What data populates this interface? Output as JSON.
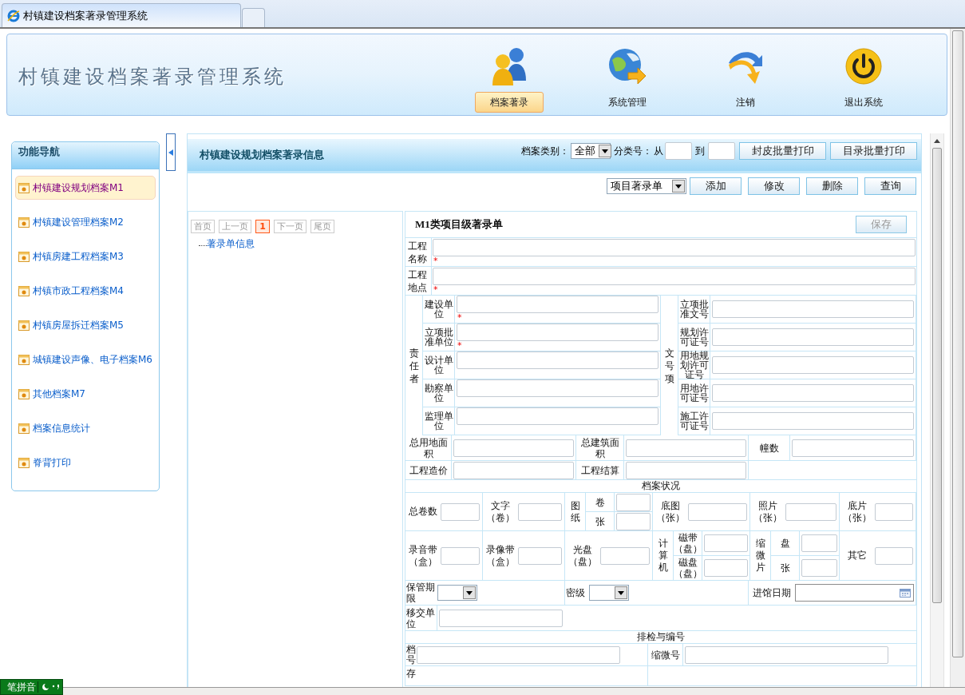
{
  "browser": {
    "tab_title": "村镇建设档案著录管理系统"
  },
  "header": {
    "title": "村镇建设档案著录管理系统",
    "nav": [
      {
        "label": "档案著录",
        "selected": true
      },
      {
        "label": "系统管理",
        "selected": false
      },
      {
        "label": "注销",
        "selected": false
      },
      {
        "label": "退出系统",
        "selected": false
      }
    ]
  },
  "sidebar": {
    "title": "功能导航",
    "items": [
      {
        "label": "村镇建设规划档案M1",
        "selected": true
      },
      {
        "label": "村镇建设管理档案M2",
        "selected": false
      },
      {
        "label": "村镇房建工程档案M3",
        "selected": false
      },
      {
        "label": "村镇市政工程档案M4",
        "selected": false
      },
      {
        "label": "村镇房屋拆迁档案M5",
        "selected": false
      },
      {
        "label": "城镇建设声像、电子档案M6",
        "selected": false
      },
      {
        "label": "其他档案M7",
        "selected": false
      },
      {
        "label": "档案信息统计",
        "selected": false
      },
      {
        "label": "脊背打印",
        "selected": false
      }
    ]
  },
  "main": {
    "title": "村镇建设规划档案著录信息",
    "category_label": "档案类别：",
    "category_value": "全部",
    "class_label": "分类号：",
    "from_label": "从",
    "to_label": "到",
    "print_buttons": [
      "封皮批量打印",
      "目录批量打印"
    ],
    "form_type": "项目著录单",
    "actions": [
      "添加",
      "修改",
      "删除",
      "查询"
    ]
  },
  "pager": {
    "items": [
      {
        "kind": "nav",
        "label": "首页",
        "disabled": true
      },
      {
        "kind": "nav",
        "label": "上一页",
        "disabled": true
      },
      {
        "kind": "page",
        "label": "1",
        "selected": true
      },
      {
        "kind": "nav",
        "label": "下一页",
        "disabled": true
      },
      {
        "kind": "nav",
        "label": "尾页",
        "disabled": true
      }
    ]
  },
  "tree": {
    "items": [
      {
        "label": "著录单信息"
      }
    ]
  },
  "form": {
    "title": "M1类项目级著录单",
    "save_button": {
      "label": "保存",
      "disabled": true
    },
    "required_mark": "*",
    "top_fields": [
      {
        "label": "工程名称",
        "required": true
      },
      {
        "label": "工程地点",
        "required": true
      }
    ],
    "responsible": {
      "label": "责任者",
      "fields": [
        {
          "label": "建设单位",
          "required": true
        },
        {
          "label": "立项批准单位",
          "required": true
        },
        {
          "label": "设计单位",
          "required": false
        },
        {
          "label": "勘察单位",
          "required": false
        },
        {
          "label": "监理单位",
          "required": false
        }
      ]
    },
    "doc_numbers": {
      "label": "文号项",
      "fields": [
        {
          "label": "立项批准文号"
        },
        {
          "label": "规划许可证号"
        },
        {
          "label": "用地规划许可证号"
        },
        {
          "label": "用地许可证号"
        },
        {
          "label": "施工许可证号"
        }
      ]
    },
    "area_rows": [
      [
        {
          "label": "总用地面积"
        },
        {
          "label": "总建筑面积"
        },
        {
          "label": "幢数"
        }
      ],
      [
        {
          "label": "工程造价"
        },
        {
          "label": "工程结算"
        }
      ]
    ],
    "status": {
      "title": "档案状况",
      "rows": [
        [
          {
            "kind": "single",
            "label": "总卷数"
          },
          {
            "kind": "single",
            "label": "文字（卷）"
          },
          {
            "kind": "split",
            "label": "图纸",
            "parts": [
              "卷",
              "张"
            ]
          },
          {
            "kind": "single",
            "label": "底图（张）"
          },
          {
            "kind": "single",
            "label": "照片（张）"
          },
          {
            "kind": "single",
            "label": "底片（张）"
          }
        ],
        [
          {
            "kind": "single",
            "label": "录音带（盒）"
          },
          {
            "kind": "single",
            "label": "录像带（盒）"
          },
          {
            "kind": "single",
            "label": "光盘（盘）"
          },
          {
            "kind": "split",
            "label": "计算机",
            "parts": [
              "磁带（盘）",
              "磁盘（盘）"
            ]
          },
          {
            "kind": "split",
            "label": "缩微片",
            "parts": [
              "盘",
              "张"
            ]
          },
          {
            "kind": "single",
            "label": "其它"
          }
        ]
      ]
    },
    "misc_fields": [
      {
        "kind": "select",
        "label": "保管期限"
      },
      {
        "kind": "select",
        "label": "密级"
      },
      {
        "kind": "date",
        "label": "进馆日期"
      }
    ],
    "transfer": {
      "label": "移交单位"
    },
    "numbering": {
      "title": "排检与编号",
      "fields": [
        {
          "label": "档号"
        },
        {
          "label": "缩微号"
        }
      ],
      "cut_label": "存"
    }
  },
  "ime": {
    "label": "笔拼音"
  }
}
